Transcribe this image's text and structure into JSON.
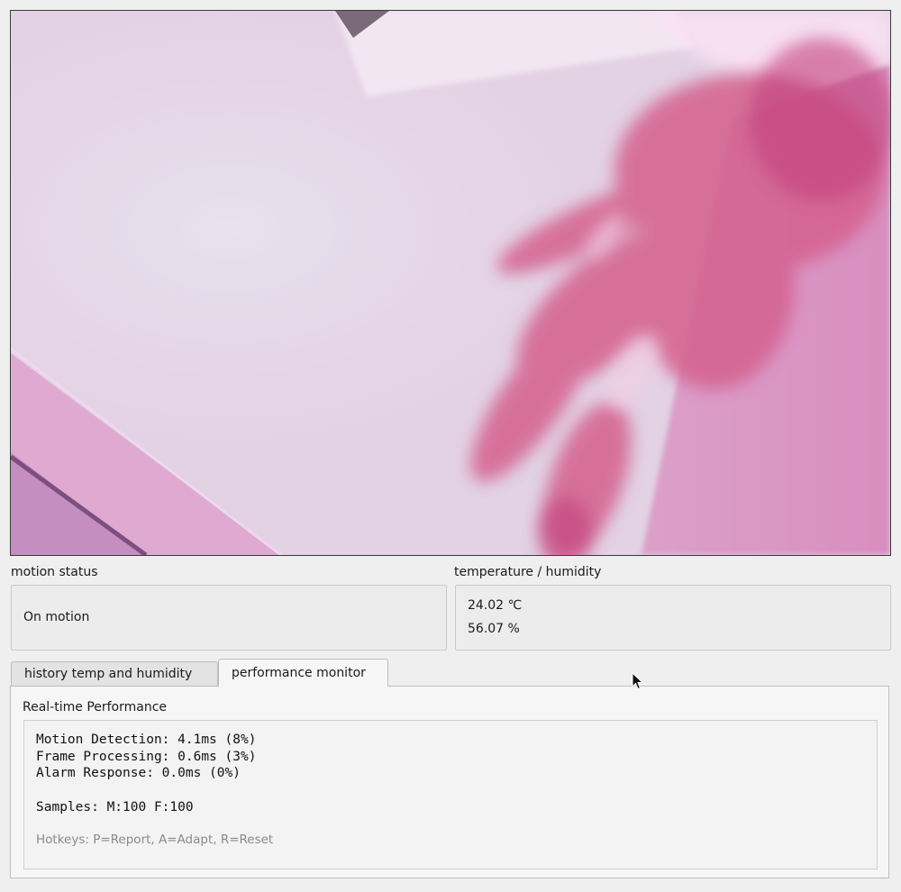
{
  "motion": {
    "label": "motion status",
    "status": "On motion"
  },
  "environment": {
    "label": "temperature / humidity",
    "temperature": "24.02 ℃",
    "humidity": "56.07 %"
  },
  "tabs": [
    {
      "label": "history temp and humidity",
      "active": false
    },
    {
      "label": "performance monitor",
      "active": true
    }
  ],
  "performance": {
    "title": "Real-time Performance",
    "motion_detection": "Motion Detection: 4.1ms (8%)",
    "frame_processing": "Frame Processing: 0.6ms (3%)",
    "alarm_response": "Alarm Response: 0.0ms (0%)",
    "samples": "Samples: M:100 F:100",
    "hotkeys": "Hotkeys: P=Report, A=Adapt, R=Reset"
  },
  "colors": {
    "camera_tint": "#e6b8d8",
    "hand": "#d65a8e"
  },
  "icons": {
    "cursor": "mouse-pointer-icon"
  }
}
